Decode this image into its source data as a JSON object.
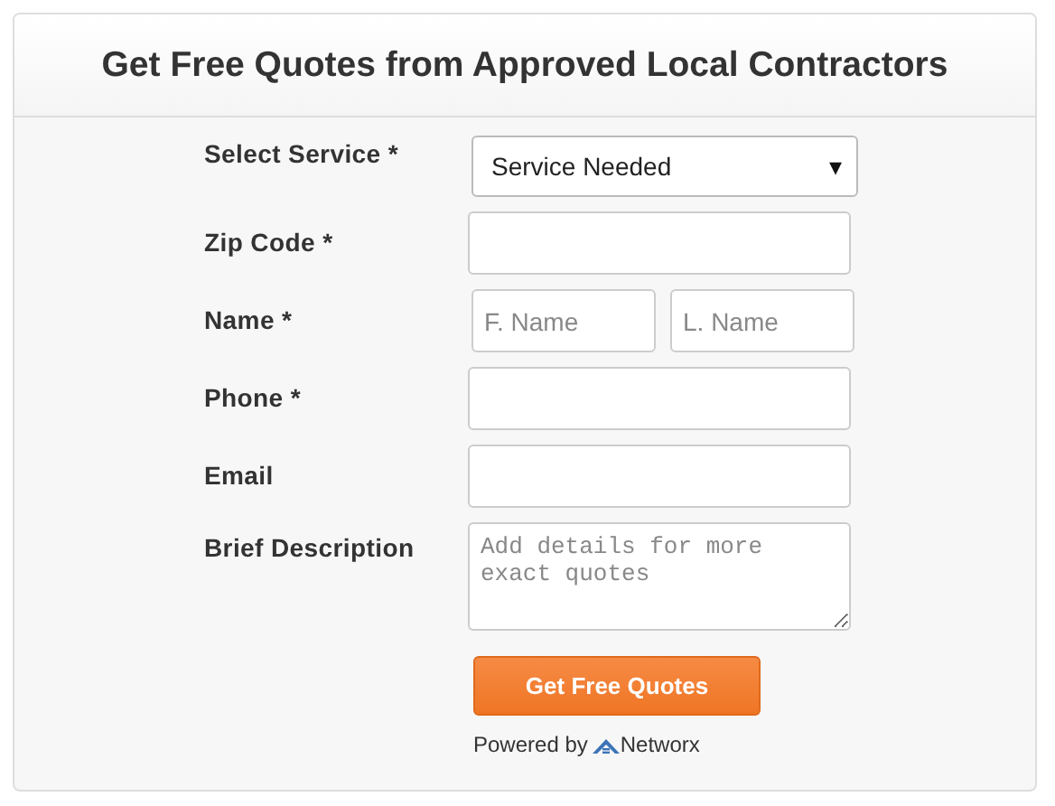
{
  "title": "Get Free Quotes from Approved Local Contractors",
  "fields": [
    {
      "kind": "select",
      "label": "Select Service *",
      "value": "Service Needed",
      "caret": "▾"
    },
    {
      "kind": "text",
      "label": "Zip Code *"
    },
    {
      "kind": "pair",
      "label": "Name *",
      "placeholders": [
        "F. Name",
        "L. Name"
      ]
    },
    {
      "kind": "text",
      "label": "Phone *"
    },
    {
      "kind": "text",
      "label": "Email"
    },
    {
      "kind": "textarea",
      "label": "Brief Description",
      "placeholder": "Add details for more exact quotes"
    }
  ],
  "submit": "Get Free Quotes",
  "powered_by": {
    "text": "Powered by",
    "brand": "Networx"
  }
}
